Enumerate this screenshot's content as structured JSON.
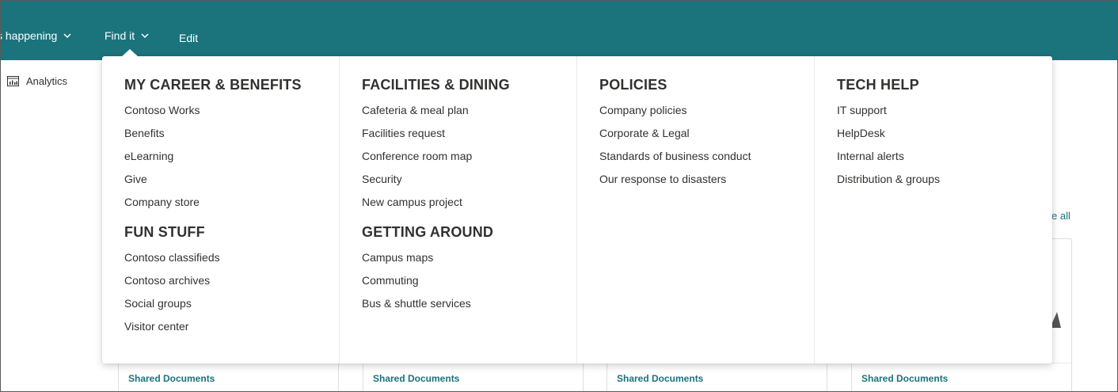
{
  "topnav": {
    "items": [
      {
        "label": "s happening",
        "has_dropdown": true
      },
      {
        "label": "Find it",
        "has_dropdown": true
      },
      {
        "label": "Edit",
        "has_dropdown": false
      }
    ],
    "background_color": "#1b737c"
  },
  "leftnav": {
    "analytics_label": "Analytics",
    "analytics_icon": "analytics-icon"
  },
  "page": {
    "see_all_label": "e all",
    "cards": [
      {
        "footer_link": "Shared Documents"
      },
      {
        "footer_link": "Shared Documents"
      },
      {
        "footer_link": "Shared Documents"
      },
      {
        "footer_link": "Shared Documents"
      }
    ]
  },
  "mega_menu": {
    "columns": [
      {
        "sections": [
          {
            "title": "MY CAREER & BENEFITS",
            "links": [
              "Contoso Works",
              "Benefits",
              "eLearning",
              "Give",
              "Company store"
            ]
          },
          {
            "title": "FUN STUFF",
            "links": [
              "Contoso classifieds",
              "Contoso archives",
              "Social groups",
              "Visitor center"
            ]
          }
        ]
      },
      {
        "sections": [
          {
            "title": "FACILITIES & DINING",
            "links": [
              "Cafeteria & meal plan",
              "Facilities request",
              "Conference room map",
              "Security",
              "New campus project"
            ]
          },
          {
            "title": "GETTING AROUND",
            "links": [
              "Campus maps",
              "Commuting",
              "Bus & shuttle services"
            ]
          }
        ]
      },
      {
        "sections": [
          {
            "title": "POLICIES",
            "links": [
              "Company policies",
              "Corporate & Legal",
              "Standards of business conduct",
              "Our response to disasters"
            ]
          }
        ]
      },
      {
        "sections": [
          {
            "title": "TECH HELP",
            "links": [
              "IT support",
              "HelpDesk",
              "Internal alerts",
              "Distribution & groups"
            ]
          }
        ]
      }
    ]
  }
}
